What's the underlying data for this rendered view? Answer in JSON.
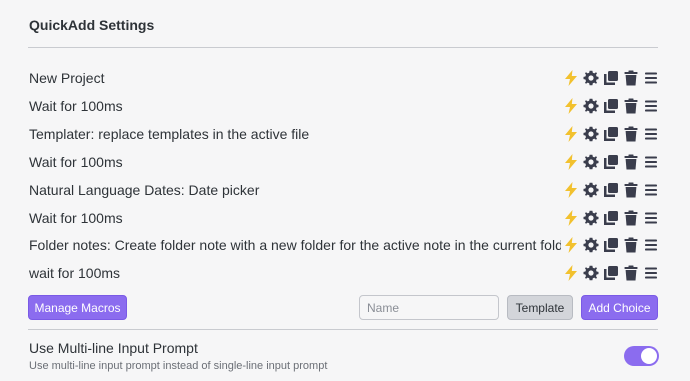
{
  "header": {
    "title": "QuickAdd Settings"
  },
  "choices": [
    {
      "label": "New Project"
    },
    {
      "label": "Wait for 100ms"
    },
    {
      "label": "Templater: replace templates in the active file"
    },
    {
      "label": "Wait for 100ms"
    },
    {
      "label": "Natural Language Dates: Date picker"
    },
    {
      "label": "Wait for 100ms"
    },
    {
      "label": "Folder notes: Create folder note with a new folder for the active note in the current folder"
    },
    {
      "label": "wait for 100ms"
    }
  ],
  "choice_actions": [
    "lightning-icon",
    "gear-icon",
    "duplicate-icon",
    "trash-icon",
    "drag-handle-icon"
  ],
  "toolbar": {
    "manage_macros_label": "Manage Macros",
    "name_placeholder": "Name",
    "name_value": "",
    "type_label": "Template",
    "add_choice_label": "Add Choice"
  },
  "settings": {
    "multiline": {
      "name": "Use Multi-line Input Prompt",
      "description": "Use multi-line input prompt instead of single-line input prompt",
      "enabled": true
    }
  },
  "colors": {
    "accent": "#8b6cef",
    "lightning": "#f2c12e",
    "icon": "#3a3d4c",
    "text": "#2e3338",
    "muted": "#6b6f76"
  }
}
